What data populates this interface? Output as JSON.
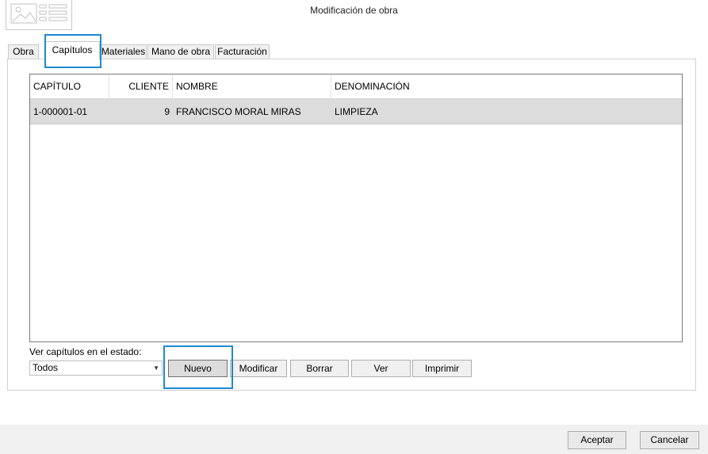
{
  "window": {
    "title": "Modificación de obra"
  },
  "tabs": [
    {
      "label": "Obra"
    },
    {
      "label": "Capítulos"
    },
    {
      "label": "Materiales"
    },
    {
      "label": "Mano de obra"
    },
    {
      "label": "Facturación"
    }
  ],
  "grid": {
    "columns": [
      "CAPÍTULO",
      "CLIENTE",
      "NOMBRE",
      "DENOMINACIÓN"
    ],
    "rows": [
      {
        "capitulo": "1-000001-01",
        "cliente": "9",
        "nombre": "FRANCISCO MORAL MIRAS",
        "denominacion": "LIMPIEZA"
      }
    ]
  },
  "filter": {
    "label": "Ver capítulos en el estado:",
    "selected": "Todos"
  },
  "actions": {
    "nuevo": "Nuevo",
    "modificar": "Modificar",
    "borrar": "Borrar",
    "ver": "Ver",
    "imprimir": "Imprimir"
  },
  "footer": {
    "aceptar": "Aceptar",
    "cancelar": "Cancelar"
  },
  "colors": {
    "highlight": "#1e88d2",
    "selected_row": "#dcdcdc"
  },
  "icons": {
    "logo": "image-placeholder-icon",
    "dropdown": "chevron-down-icon"
  }
}
